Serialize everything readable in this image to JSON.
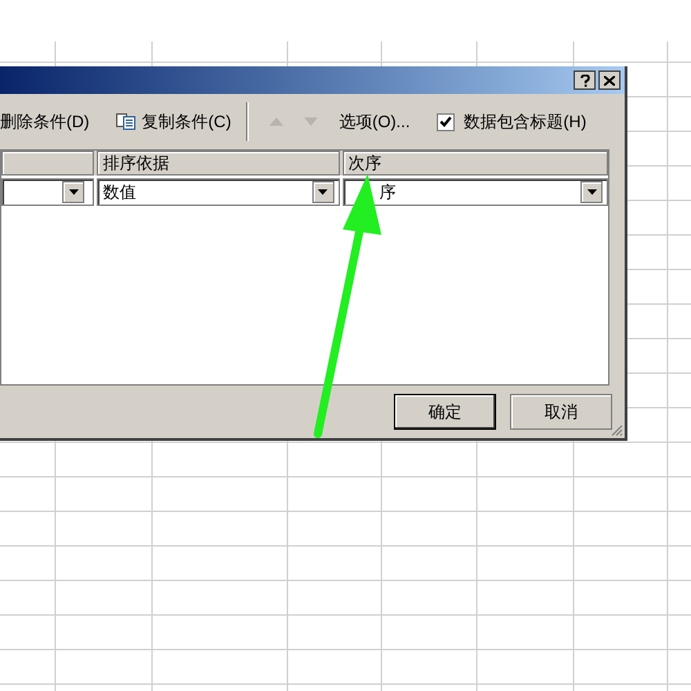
{
  "toolbar": {
    "delete_condition": "删除条件(D)",
    "copy_condition": "复制条件(C)",
    "move_up_disabled": true,
    "move_down_disabled": true,
    "options": "选项(O)...",
    "has_headers": {
      "label": "数据包含标题(H)",
      "checked": true
    }
  },
  "table": {
    "columns": [
      "",
      "排序依据",
      "次序"
    ],
    "rows": [
      {
        "cells": [
          "",
          "数值",
          "序"
        ]
      }
    ]
  },
  "buttons": {
    "ok": "确定",
    "cancel": "取消"
  }
}
